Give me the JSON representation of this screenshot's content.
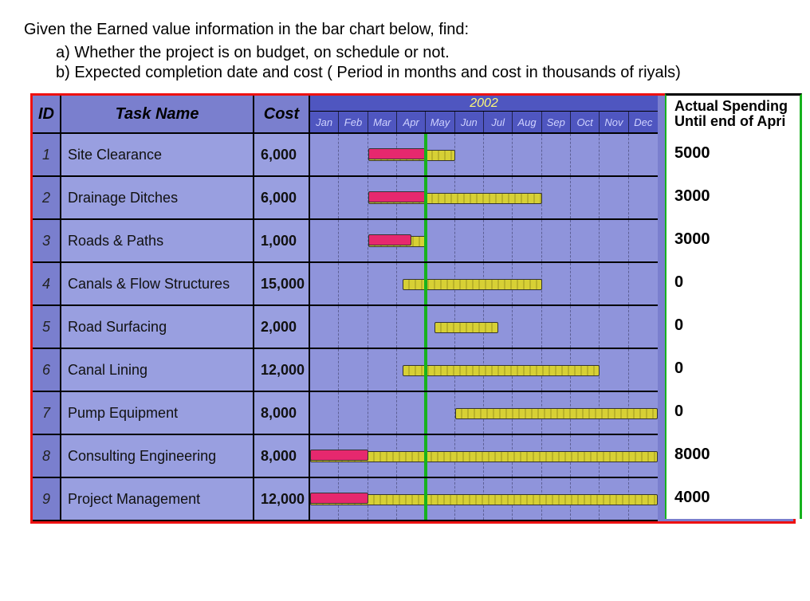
{
  "intro": "Given the Earned value information in the bar chart below, find:",
  "questions": {
    "a": "a)   Whether the project is on budget, on schedule or not.",
    "b": "b)   Expected completion date and cost ( Period in months and cost in thousands of riyals)"
  },
  "header": {
    "id": "ID",
    "task": "Task Name",
    "cost": "Cost",
    "year": "2002",
    "months": [
      "Jan",
      "Feb",
      "Mar",
      "Apr",
      "May",
      "Jun",
      "Jul",
      "Aug",
      "Sep",
      "Oct",
      "Nov",
      "Dec"
    ]
  },
  "spend_header_l1": "Actual Spending",
  "spend_header_l2": "Until end of Apri",
  "status_month_index": 4,
  "tasks": [
    {
      "id": "1",
      "name": "Site Clearance",
      "cost": "6,000",
      "spend": "5000",
      "plan_start": 2.0,
      "plan_end": 5.0,
      "actual_start": 2.0,
      "actual_end": 4.0
    },
    {
      "id": "2",
      "name": "Drainage Ditches",
      "cost": "6,000",
      "spend": "3000",
      "plan_start": 2.0,
      "plan_end": 8.0,
      "actual_start": 2.0,
      "actual_end": 4.0
    },
    {
      "id": "3",
      "name": "Roads & Paths",
      "cost": "1,000",
      "spend": "3000",
      "plan_start": 2.0,
      "plan_end": 4.0,
      "actual_start": 2.0,
      "actual_end": 3.5
    },
    {
      "id": "4",
      "name": "Canals & Flow Structures",
      "cost": "15,000",
      "spend": "0",
      "plan_start": 3.2,
      "plan_end": 8.0,
      "actual_start": null,
      "actual_end": null
    },
    {
      "id": "5",
      "name": "Road Surfacing",
      "cost": "2,000",
      "spend": "0",
      "plan_start": 4.3,
      "plan_end": 6.5,
      "actual_start": null,
      "actual_end": null
    },
    {
      "id": "6",
      "name": "Canal Lining",
      "cost": "12,000",
      "spend": "0",
      "plan_start": 3.2,
      "plan_end": 10.0,
      "actual_start": null,
      "actual_end": null
    },
    {
      "id": "7",
      "name": "Pump Equipment",
      "cost": "8,000",
      "spend": "0",
      "plan_start": 5.0,
      "plan_end": 12.0,
      "actual_start": null,
      "actual_end": null
    },
    {
      "id": "8",
      "name": "Consulting Engineering",
      "cost": "8,000",
      "spend": "8000",
      "plan_start": 0.0,
      "plan_end": 12.0,
      "actual_start": 0.0,
      "actual_end": 2.0
    },
    {
      "id": "9",
      "name": "Project Management",
      "cost": "12,000",
      "spend": "4000",
      "plan_start": 0.0,
      "plan_end": 12.0,
      "actual_start": 0.0,
      "actual_end": 2.0
    }
  ],
  "chart_data": {
    "type": "gantt",
    "title": "Earned Value Gantt Chart",
    "year": 2002,
    "x_categories": [
      "Jan",
      "Feb",
      "Mar",
      "Apr",
      "May",
      "Jun",
      "Jul",
      "Aug",
      "Sep",
      "Oct",
      "Nov",
      "Dec"
    ],
    "status_date": "end of Apr 2002",
    "cost_unit": "thousands of riyals",
    "series": [
      {
        "name": "Planned",
        "items": [
          {
            "task": "Site Clearance",
            "start_month": 3,
            "end_month": 5
          },
          {
            "task": "Drainage Ditches",
            "start_month": 3,
            "end_month": 8
          },
          {
            "task": "Roads & Paths",
            "start_month": 3,
            "end_month": 4
          },
          {
            "task": "Canals & Flow Structures",
            "start_month": 4,
            "end_month": 8
          },
          {
            "task": "Road Surfacing",
            "start_month": 5,
            "end_month": 7
          },
          {
            "task": "Canal Lining",
            "start_month": 4,
            "end_month": 10
          },
          {
            "task": "Pump Equipment",
            "start_month": 6,
            "end_month": 12
          },
          {
            "task": "Consulting Engineering",
            "start_month": 1,
            "end_month": 12
          },
          {
            "task": "Project Management",
            "start_month": 1,
            "end_month": 12
          }
        ]
      },
      {
        "name": "Actual",
        "items": [
          {
            "task": "Site Clearance",
            "start_month": 3,
            "end_month": 4
          },
          {
            "task": "Drainage Ditches",
            "start_month": 3,
            "end_month": 4
          },
          {
            "task": "Roads & Paths",
            "start_month": 3,
            "end_month": 3.5
          },
          {
            "task": "Consulting Engineering",
            "start_month": 1,
            "end_month": 2
          },
          {
            "task": "Project Management",
            "start_month": 1,
            "end_month": 2
          }
        ]
      }
    ],
    "columns": {
      "Cost": [
        6000,
        6000,
        1000,
        15000,
        2000,
        12000,
        8000,
        8000,
        12000
      ],
      "Actual Spending Until end of April": [
        5000,
        3000,
        3000,
        0,
        0,
        0,
        0,
        8000,
        4000
      ]
    }
  }
}
